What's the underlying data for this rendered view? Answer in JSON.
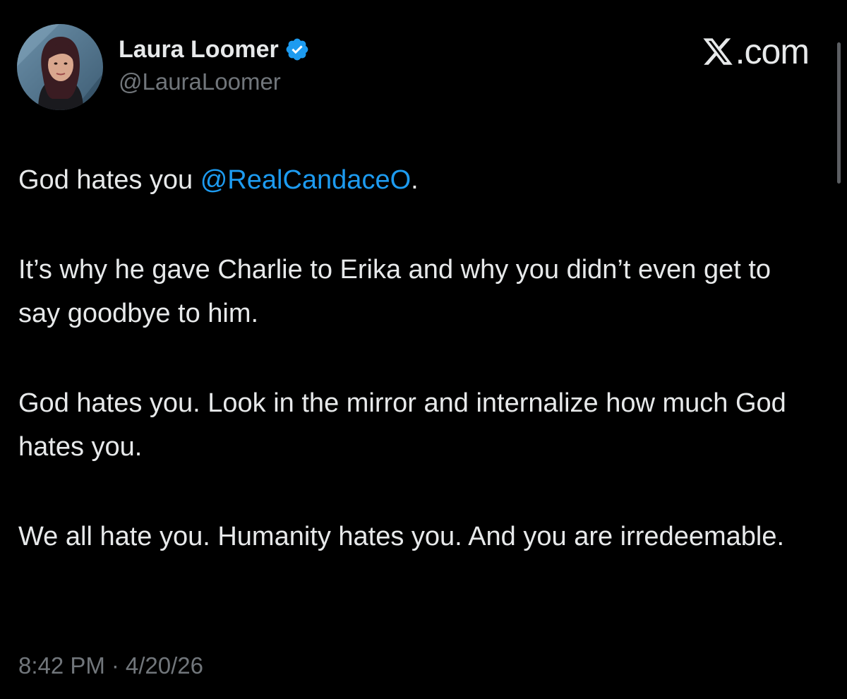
{
  "author": {
    "display_name": "Laura Loomer",
    "handle": "@LauraLoomer",
    "verified_icon": "verified-badge-icon"
  },
  "brand": {
    "label": ".com",
    "icon": "x-logo-icon"
  },
  "post": {
    "p1_before": "God hates you ",
    "mention": "@RealCandaceO",
    "p1_after": ".",
    "p2": "It’s why he gave Charlie to Erika and why you didn’t even get to say goodbye to him.",
    "p3": "God hates you. Look in the mirror and internalize how much God hates you.",
    "p4": "We all hate you. Humanity hates you. And you are irredeemable."
  },
  "meta": {
    "time": "8:42 PM",
    "separator": "·",
    "date": "4/20/26"
  },
  "colors": {
    "background": "#000000",
    "text": "#e7e9ea",
    "muted": "#71767b",
    "link": "#1d9bf0"
  }
}
